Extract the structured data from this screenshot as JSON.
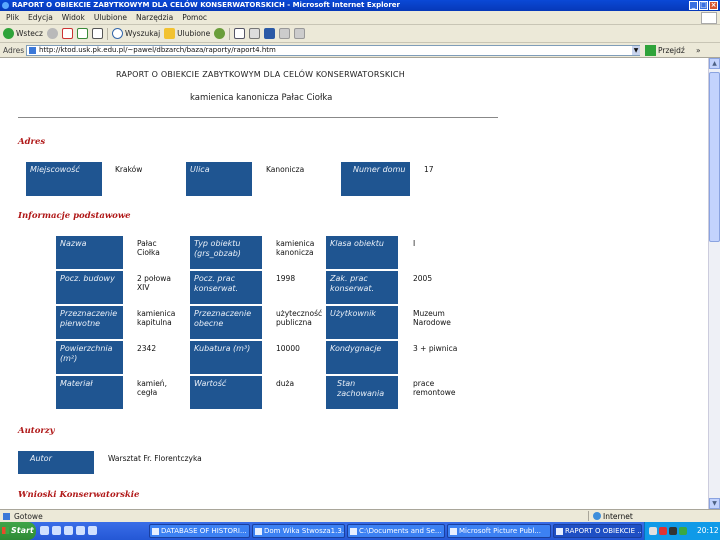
{
  "window": {
    "title": "RAPORT O OBIEKCIE ZABYTKOWYM DLA CELÓW KONSERWATORSKICH - Microsoft Internet Explorer",
    "min": "_",
    "max": "□",
    "close": "×"
  },
  "menu": [
    "Plik",
    "Edycja",
    "Widok",
    "Ulubione",
    "Narzędzia",
    "Pomoc"
  ],
  "toolbar": {
    "back": "Wstecz",
    "search": "Wyszukaj",
    "favorites": "Ulubione"
  },
  "address": {
    "label": "Adres",
    "url": "http://ktod.usk.pk.edu.pl/~pawel/dbzarch/baza/raporty/raport4.htm",
    "go": "Przejdź",
    "links": "»"
  },
  "report": {
    "title": "RAPORT O OBIEKCIE ZABYTKOWYM DLA CELÓW KONSERWATORSKICH",
    "subtitle": "kamienica kanonicza Pałac Ciołka",
    "sections": {
      "address": "Adres",
      "basic": "Informacje podstawowe",
      "authors": "Autorzy",
      "conservation": "Wnioski Konserwatorskie"
    },
    "address": {
      "city_label": "Miejscowość",
      "city": "Kraków",
      "street_label": "Ulica",
      "street": "Kanonicza",
      "number_label": "Numer domu",
      "number": "17"
    },
    "basic": {
      "row1": {
        "l1": "Nazwa",
        "v1": "Pałac Ciołka",
        "l2": "Typ obiektu (grs_obzab)",
        "v2": "kamienica kanonicza",
        "l3": "Klasa obiektu",
        "v3": "I"
      },
      "row2": {
        "l1": "Pocz. budowy",
        "v1": "2 połowa XIV",
        "l2": "Pocz. prac konserwat.",
        "v2": "1998",
        "l3": "Zak. prac konserwat.",
        "v3": "2005"
      },
      "row3": {
        "l1": "Przeznaczenie pierwotne",
        "v1": "kamienica kapitulna",
        "l2": "Przeznaczenie obecne",
        "v2": "użyteczność publiczna",
        "l3": "Użytkownik",
        "v3": "Muzeum Narodowe"
      },
      "row4": {
        "l1": "Powierzchnia (m²)",
        "v1": "2342",
        "l2": "Kubatura (m³)",
        "v2": "10000",
        "l3": "Kondygnacje",
        "v3": "3 + piwnica"
      },
      "row5": {
        "l1": "Materiał",
        "v1": "kamień, cegła",
        "l2": "Wartość",
        "v2": "duża",
        "l3": "Stan zachowania",
        "v3": "prace remontowe"
      }
    },
    "authors": {
      "label": "Autor",
      "value": "Warsztat Fr. Florentczyka"
    }
  },
  "status": {
    "text": "Gotowe",
    "zone": "Internet"
  },
  "taskbar": {
    "start": "Start",
    "tasks": [
      "DATABASE OF HISTORI...",
      "Dom Wika Stwosza1.3...",
      "C:\\Documents and Se...",
      "Microsoft Picture Publ...",
      "RAPORT O OBIEKCIE ..."
    ],
    "clock": "20:12"
  },
  "colors": {
    "cell_bg": "#1f5591",
    "section": "#b01818"
  }
}
